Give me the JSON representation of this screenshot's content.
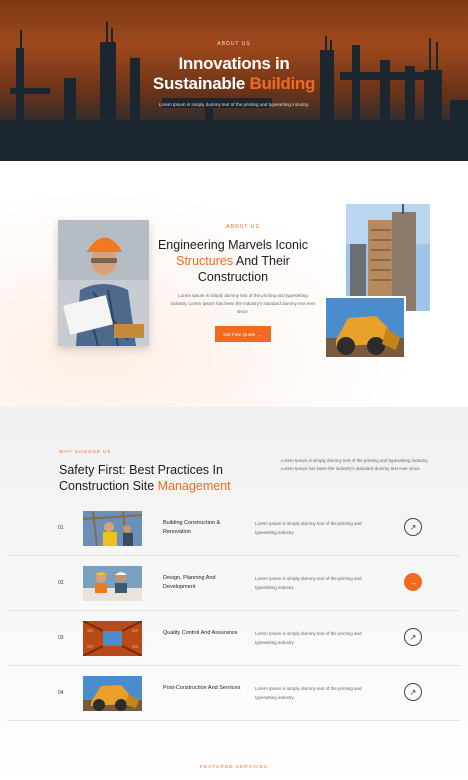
{
  "hero": {
    "eyebrow": "ABOUT US",
    "title_line1": "Innovations in",
    "title_line2_plain": "Sustainable ",
    "title_line2_accent": "Building",
    "subtitle": "Lorem Ipsum is simply dummy text of the printing and typesetting industry."
  },
  "about": {
    "eyebrow": "ABOUT US",
    "title_part1": "Engineering Marvels Iconic",
    "title_accent": "Structures",
    "title_part2": " And Their",
    "title_part3": "Construction",
    "text": "Lorem Ipsum is simply dummy text of the printing and typesetting industry. Lorem Ipsum has been the industry's standard dummy text ever since.",
    "button_label": "Get Free Quote",
    "button_arrow": "→"
  },
  "why": {
    "eyebrow": "WHY CHOOSE US",
    "title_part1": "Safety First: Best Practices In Construction Site ",
    "title_accent": "Management",
    "text": "Lorem Ipsum is simply dummy text of the printing and typesetting industry. Lorem Ipsum has been the industry's standard dummy text ever since.",
    "services": [
      {
        "num": "01",
        "title": "Building Construction & Renovation",
        "desc": "Lorem Ipsum is simply dummy text of the printing and typesetting industry.",
        "arrow": "↗",
        "active": false
      },
      {
        "num": "02",
        "title": "Design, Planning And Development",
        "desc": "Lorem Ipsum is simply dummy text of the printing and typesetting industry.",
        "arrow": "→",
        "active": true
      },
      {
        "num": "03",
        "title": "Quality Control And Assurance",
        "desc": "Lorem Ipsum is simply dummy text of the printing and typesetting industry.",
        "arrow": "↗",
        "active": false
      },
      {
        "num": "04",
        "title": "Post-Construction And Services",
        "desc": "Lorem Ipsum is simply dummy text of the printing and typesetting industry.",
        "arrow": "↗",
        "active": false
      }
    ]
  },
  "featured": {
    "eyebrow": "FEATURED SERVICES"
  },
  "colors": {
    "accent": "#f26a21",
    "dark": "#1a2530"
  }
}
